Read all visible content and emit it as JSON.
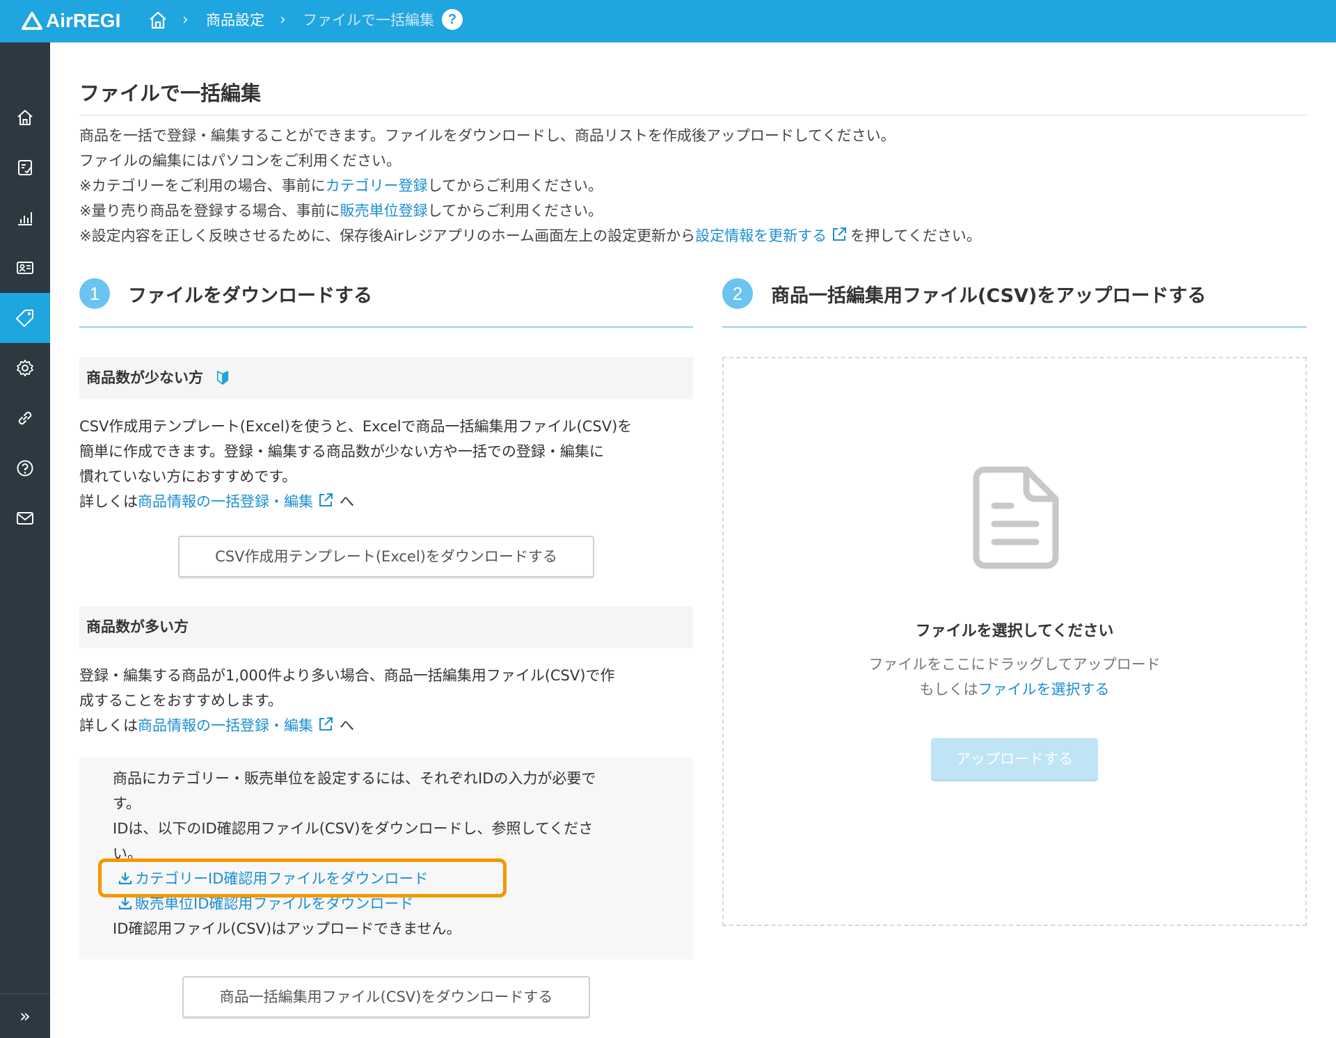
{
  "header": {
    "logo_text": "AirREGI",
    "breadcrumb_1": "商品設定",
    "breadcrumb_2": "ファイルで一括編集",
    "help": "?",
    "sep": "›"
  },
  "sidebar": {
    "items": [
      {
        "icon": "home-icon"
      },
      {
        "icon": "checklist-icon"
      },
      {
        "icon": "bar-chart-icon"
      },
      {
        "icon": "id-card-icon"
      },
      {
        "icon": "tag-icon",
        "active": true
      },
      {
        "icon": "gear-icon"
      },
      {
        "icon": "link-icon"
      },
      {
        "icon": "question-icon"
      },
      {
        "icon": "mail-icon"
      }
    ],
    "expand_label": "»"
  },
  "page": {
    "title": "ファイルで一括編集",
    "desc_1": "商品を一括で登録・編集することができます。ファイルをダウンロードし、商品リストを作成後アップロードしてください。",
    "desc_2": "ファイルの編集にはパソコンをご利用ください。",
    "desc_3_pre": "※カテゴリーをご利用の場合、事前に",
    "desc_3_link": "カテゴリー登録",
    "desc_3_post": "してからご利用ください。",
    "desc_4_pre": "※量り売り商品を登録する場合、事前に",
    "desc_4_link": "販売単位登録",
    "desc_4_post": "してからご利用ください。",
    "desc_5_pre": "※設定内容を正しく反映させるために、保存後Airレジアプリのホーム画面左上の設定更新から",
    "desc_5_link": "設定情報を更新する",
    "desc_5_post": "を押してください。"
  },
  "step1": {
    "num": "1",
    "label": "ファイルをダウンロードする",
    "few": {
      "heading": "商品数が少ない方",
      "text_1": "CSV作成用テンプレート(Excel)を使うと、Excelで商品一括編集用ファイル(CSV)を",
      "text_2": "簡単に作成できます。登録・編集する商品数が少ない方や一括での登録・編集に",
      "text_3": "慣れていない方におすすめです。",
      "more_pre": "詳しくは",
      "more_link": "商品情報の一括登録・編集",
      "more_post": "へ",
      "button": "CSV作成用テンプレート(Excel)をダウンロードする"
    },
    "many": {
      "heading": "商品数が多い方",
      "text_1": "登録・編集する商品が1,000件より多い場合、商品一括編集用ファイル(CSV)で作",
      "text_2": "成することをおすすめします。",
      "more_pre": "詳しくは",
      "more_link": "商品情報の一括登録・編集",
      "more_post": "へ",
      "note_1": "商品にカテゴリー・販売単位を設定するには、それぞれIDの入力が必要で",
      "note_2": "す。",
      "note_3": "IDは、以下のID確認用ファイル(CSV)をダウンロードし、参照してくださ",
      "note_4": "い。",
      "dl_category": "カテゴリーID確認用ファイルをダウンロード",
      "dl_unit": "販売単位ID確認用ファイルをダウンロード",
      "note_5": "ID確認用ファイル(CSV)はアップロードできません。",
      "button": "商品一括編集用ファイル(CSV)をダウンロードする"
    }
  },
  "step2": {
    "num": "2",
    "label": "商品一括編集用ファイル(CSV)をアップロードする",
    "dz_title": "ファイルを選択してください",
    "dz_line_1": "ファイルをここにドラッグしてアップロード",
    "dz_line_2_pre": "もしくは",
    "dz_line_2_link": "ファイルを選択する",
    "upload_button": "アップロードする"
  },
  "colors": {
    "header_bg": "#1fa5e0",
    "sidebar_bg": "#2c3941",
    "link": "#1a8fd2",
    "highlight": "#f39800"
  }
}
